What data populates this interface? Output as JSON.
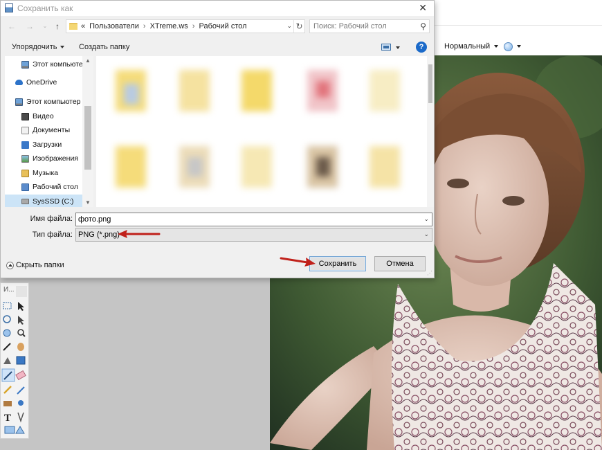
{
  "dialog": {
    "title": "Сохранить как",
    "breadcrumb": [
      "«",
      "Пользователи",
      "XTreme.ws",
      "Рабочий стол"
    ],
    "search_placeholder": "Поиск: Рабочий стол",
    "organize_label": "Упорядочить",
    "new_folder_label": "Создать папку",
    "nav_items": [
      {
        "label": "Этот компьютер",
        "icon": "computer-icon"
      },
      {
        "label": "OneDrive",
        "icon": "onedrive-icon"
      },
      {
        "label": "Этот компьютер",
        "icon": "computer-icon"
      },
      {
        "label": "Видео",
        "icon": "video-folder-icon"
      },
      {
        "label": "Документы",
        "icon": "documents-folder-icon"
      },
      {
        "label": "Загрузки",
        "icon": "downloads-folder-icon"
      },
      {
        "label": "Изображения",
        "icon": "pictures-folder-icon"
      },
      {
        "label": "Музыка",
        "icon": "music-folder-icon"
      },
      {
        "label": "Рабочий стол",
        "icon": "desktop-folder-icon"
      },
      {
        "label": "SysSSD (C:)",
        "icon": "drive-icon"
      }
    ],
    "filename_label": "Имя файла:",
    "filename_value": "фото.png",
    "filetype_label": "Тип файла:",
    "filetype_value": "PNG (*.png)",
    "hide_folders_label": "Скрыть папки",
    "save_label": "Сохранить",
    "cancel_label": "Отмена"
  },
  "background_app": {
    "zoom_label": "Нормальный",
    "tools_title": "И..."
  },
  "colors": {
    "accent": "#1b6ac9",
    "annotation_arrow": "#c0201a",
    "selection": "#cce4f7"
  }
}
